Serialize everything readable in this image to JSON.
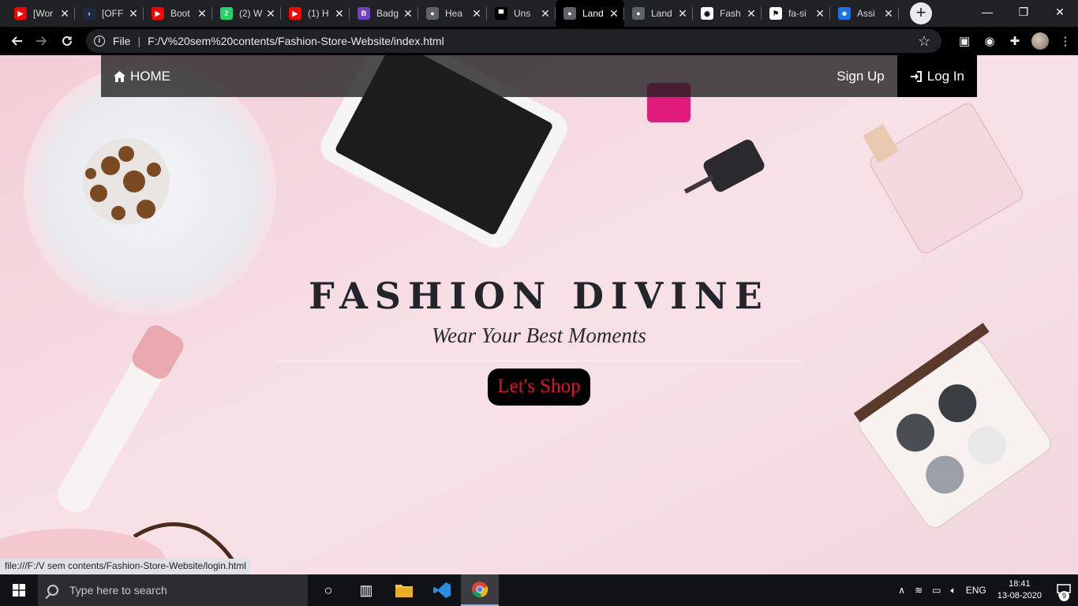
{
  "browser": {
    "tabs": [
      {
        "title": "[Wor",
        "favicon": "youtube-icon",
        "color": "#ff0000",
        "glyph": "▶"
      },
      {
        "title": "[OFF",
        "favicon": "chevron-right-icon",
        "color": "#1e2a44",
        "glyph": "›"
      },
      {
        "title": "Boot",
        "favicon": "youtube-icon",
        "color": "#ff0000",
        "glyph": "▶"
      },
      {
        "title": "(2) W",
        "favicon": "whatsapp-icon",
        "color": "#25d366",
        "glyph": "2"
      },
      {
        "title": "(1) H",
        "favicon": "youtube-icon",
        "color": "#ff0000",
        "glyph": "▶"
      },
      {
        "title": "Badg",
        "favicon": "bootstrap-icon",
        "color": "#6f42c1",
        "glyph": "B"
      },
      {
        "title": "Hea",
        "favicon": "globe-icon",
        "color": "#5f6368",
        "glyph": "●"
      },
      {
        "title": "Uns",
        "favicon": "unsplash-icon",
        "color": "#000000",
        "glyph": "▀"
      },
      {
        "title": "Land",
        "favicon": "globe-icon",
        "color": "#5f6368",
        "glyph": "●",
        "active": true
      },
      {
        "title": "Land",
        "favicon": "globe-icon",
        "color": "#5f6368",
        "glyph": "●"
      },
      {
        "title": "Fash",
        "favicon": "github-icon",
        "color": "#ffffff",
        "glyph": "◉"
      },
      {
        "title": "fa-si",
        "favicon": "flag-icon",
        "color": "#ffffff",
        "glyph": "⚑"
      },
      {
        "title": "Assi",
        "favicon": "contacts-icon",
        "color": "#1a73e8",
        "glyph": "☻"
      }
    ],
    "scheme": "File",
    "url": "F:/V%20sem%20contents/Fashion-Store-Website/index.html",
    "status_url": "file:///F:/V sem contents/Fashion-Store-Website/login.html"
  },
  "site": {
    "nav": {
      "home": "HOME",
      "signup": "Sign Up",
      "login": "Log In"
    },
    "hero": {
      "title": "FASHION DIVINE",
      "subtitle": "Wear Your Best Moments",
      "cta": "Let's Shop"
    }
  },
  "taskbar": {
    "search_placeholder": "Type here to search",
    "language": "ENG",
    "time": "18:41",
    "date": "13-08-2020",
    "notifications": "9"
  }
}
